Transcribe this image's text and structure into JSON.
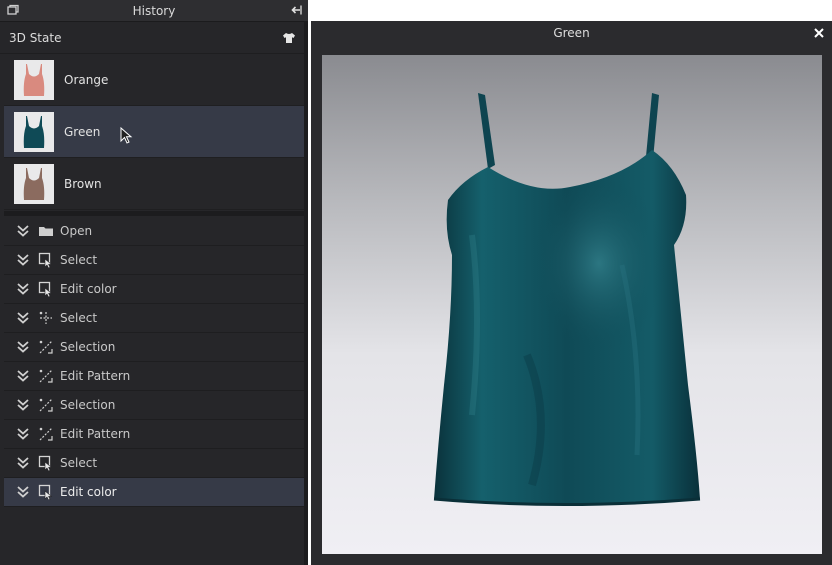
{
  "history_panel": {
    "title": "History",
    "state_header": "3D State",
    "states": [
      {
        "label": "Orange",
        "color": "#d98a7f"
      },
      {
        "label": "Green",
        "color": "#0f4a56"
      },
      {
        "label": "Brown",
        "color": "#8b6b5f"
      }
    ],
    "selected_state": "Green",
    "actions": [
      {
        "label": "Open",
        "icon": "folder-icon"
      },
      {
        "label": "Select",
        "icon": "select-pointer-icon"
      },
      {
        "label": "Edit color",
        "icon": "select-pointer-icon"
      },
      {
        "label": "Select",
        "icon": "transform-icon"
      },
      {
        "label": "Selection",
        "icon": "edit-pattern-icon"
      },
      {
        "label": "Edit Pattern",
        "icon": "edit-pattern-icon"
      },
      {
        "label": "Selection",
        "icon": "edit-pattern-icon"
      },
      {
        "label": "Edit Pattern",
        "icon": "edit-pattern-icon"
      },
      {
        "label": "Select",
        "icon": "select-pointer-icon"
      },
      {
        "label": "Edit color",
        "icon": "select-pointer-icon"
      }
    ],
    "selected_action_index": 9
  },
  "viewer": {
    "title": "Green",
    "garment_color": "#0f4a56",
    "accent": "#363a47"
  }
}
